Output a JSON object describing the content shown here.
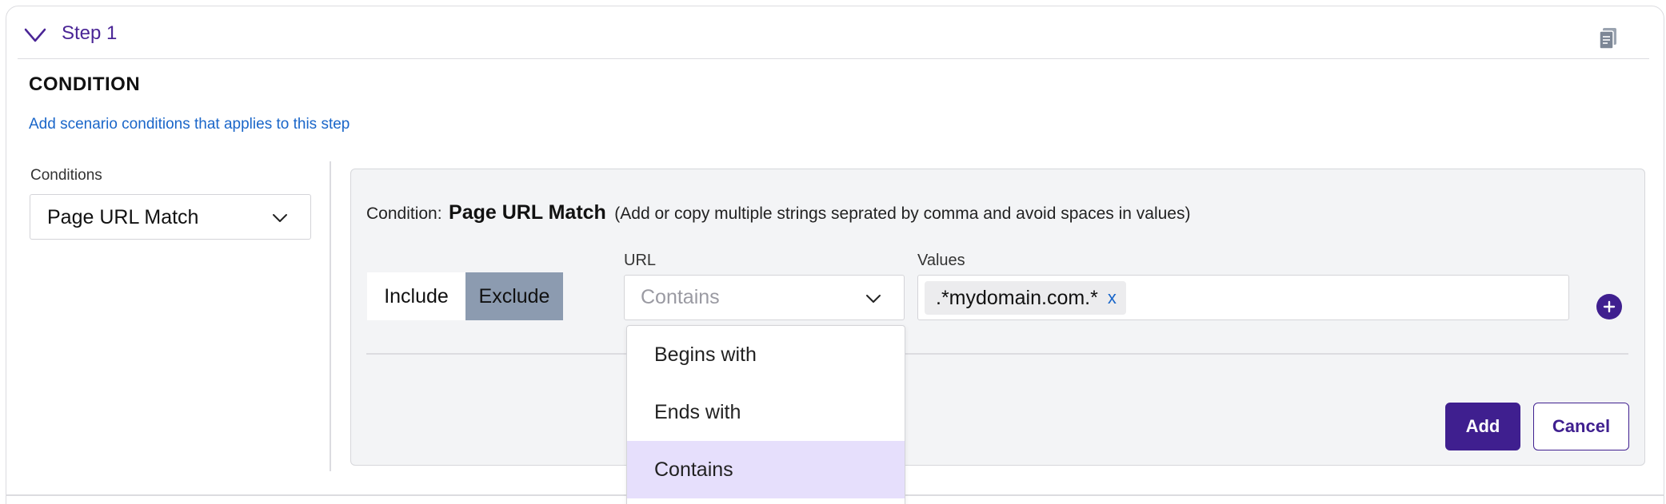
{
  "step": {
    "title": "Step 1",
    "doc_icon": "document-icon"
  },
  "section": {
    "title": "CONDITION",
    "link": "Add scenario conditions that applies to this step"
  },
  "conditions": {
    "label": "Conditions",
    "selected": "Page URL Match"
  },
  "panel": {
    "heading_prefix": "Condition:",
    "heading_name": "Page URL Match",
    "heading_note": "(Add or copy multiple strings seprated by comma and avoid spaces in values)",
    "include_label": "Include",
    "exclude_label": "Exclude",
    "active_toggle": "Exclude",
    "url_label": "URL",
    "url_value": "Contains",
    "values_label": "Values",
    "value_chips": [
      ".*mydomain.com.*"
    ],
    "chip_remove": "x",
    "add_button": "Add",
    "cancel_button": "Cancel"
  },
  "dropdown": {
    "options": [
      "Begins with",
      "Ends with",
      "Contains"
    ],
    "selected": "Contains"
  },
  "colors": {
    "accent": "#3f1f8f",
    "link": "#1a66c9",
    "toggle_active": "#8c9bb0",
    "option_selected": "#e6dffc"
  }
}
